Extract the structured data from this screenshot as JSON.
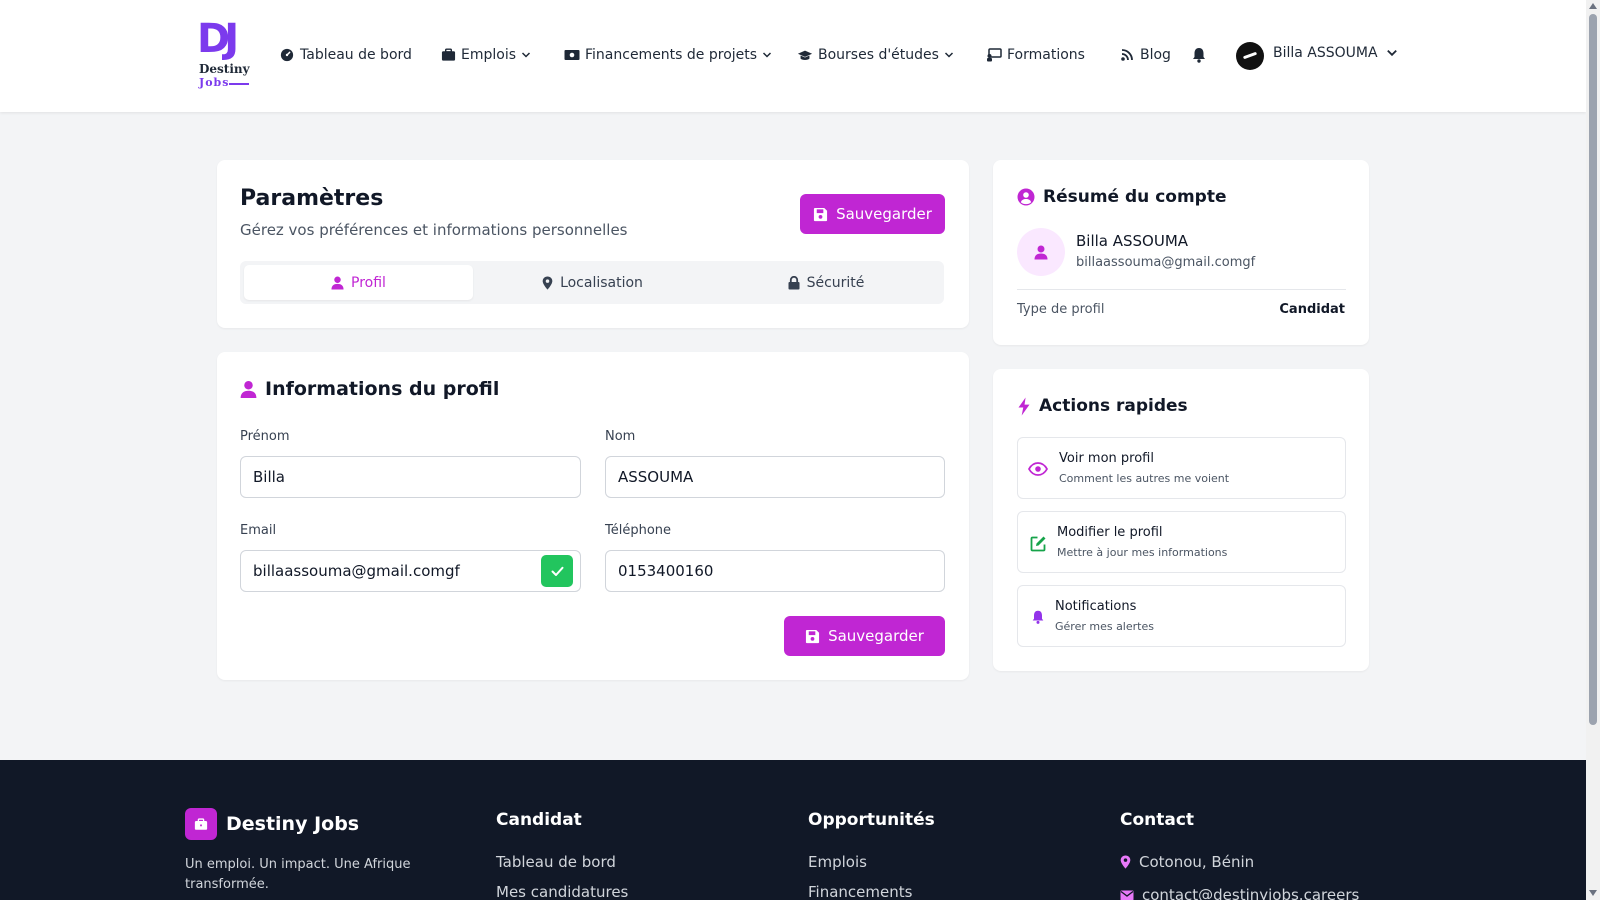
{
  "brand": {
    "logo_mono": "DJ",
    "logo_word1": "Destiny",
    "logo_word2": "Jobs"
  },
  "nav": {
    "dashboard": "Tableau de bord",
    "jobs": "Emplois",
    "funding": "Financements de projets",
    "scholarships": "Bourses d'études",
    "trainings": "Formations",
    "blog": "Blog",
    "user_name": "Billa ASSOUMA"
  },
  "settings": {
    "title": "Paramètres",
    "subtitle": "Gérez vos préférences et informations personnelles",
    "save_label": "Sauvegarder",
    "tabs": [
      {
        "label": "Profil",
        "icon": "user-icon",
        "active": true
      },
      {
        "label": "Localisation",
        "icon": "map-pin-icon",
        "active": false
      },
      {
        "label": "Sécurité",
        "icon": "lock-icon",
        "active": false
      }
    ]
  },
  "profile_form": {
    "title": "Informations du profil",
    "first_name_label": "Prénom",
    "first_name_value": "Billa",
    "last_name_label": "Nom",
    "last_name_value": "ASSOUMA",
    "email_label": "Email",
    "email_value": "billaassouma@gmail.comgf",
    "phone_label": "Téléphone",
    "phone_value": "0153400160",
    "save_label": "Sauvegarder"
  },
  "account_summary": {
    "title": "Résumé du compte",
    "name": "Billa ASSOUMA",
    "email": "billaassouma@gmail.comgf",
    "profile_type_label": "Type de profil",
    "profile_type_value": "Candidat"
  },
  "quick_actions": {
    "title": "Actions rapides",
    "items": [
      {
        "title": "Voir mon profil",
        "subtitle": "Comment les autres me voient",
        "icon": "eye-icon"
      },
      {
        "title": "Modifier le profil",
        "subtitle": "Mettre à jour mes informations",
        "icon": "edit-icon"
      },
      {
        "title": "Notifications",
        "subtitle": "Gérer mes alertes",
        "icon": "bell-icon"
      }
    ]
  },
  "footer": {
    "brand": "Destiny Jobs",
    "tagline": "Un emploi. Un impact. Une Afrique transformée.",
    "col_candidate": "Candidat",
    "candidate_links": [
      "Tableau de bord",
      "Mes candidatures"
    ],
    "col_opportunities": "Opportunités",
    "opportunity_links": [
      "Emplois",
      "Financements"
    ],
    "col_contact": "Contact",
    "location": "Cotonou, Bénin",
    "email": "contact@destinyjobs.careers"
  },
  "colors": {
    "accent": "#c026d3",
    "brand_purple": "#7c3aed",
    "success": "#22c55e",
    "action_eye": "#c026d3",
    "action_edit": "#16a34a",
    "action_bell": "#9333ea",
    "footer_bg": "#111827"
  }
}
